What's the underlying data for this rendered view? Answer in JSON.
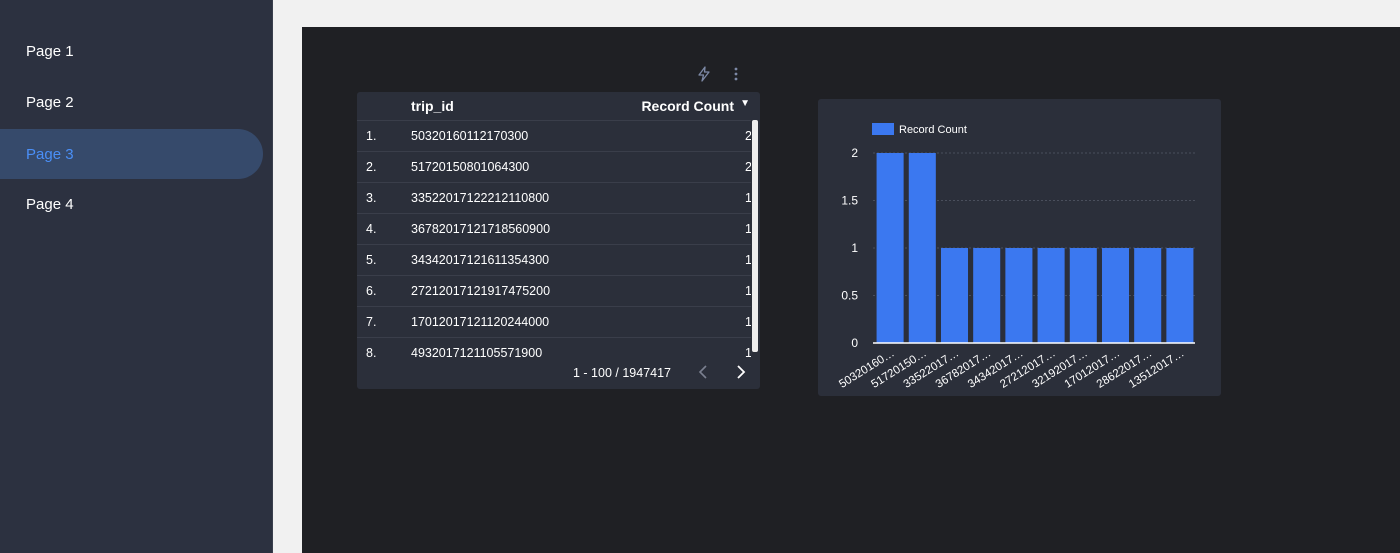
{
  "sidebar": {
    "pages": [
      {
        "label": "Page 1",
        "active": false
      },
      {
        "label": "Page 2",
        "active": false
      },
      {
        "label": "Page 3",
        "active": true
      },
      {
        "label": "Page 4",
        "active": false
      }
    ]
  },
  "toolbar": {
    "icons": [
      "lightning-icon",
      "more-vert-icon"
    ]
  },
  "table": {
    "columns": [
      "trip_id",
      "Record Count"
    ],
    "rows": [
      {
        "index": "1.",
        "trip_id": "50320160112170300",
        "count": "2"
      },
      {
        "index": "2.",
        "trip_id": "51720150801064300",
        "count": "2"
      },
      {
        "index": "3.",
        "trip_id": "33522017122212110800",
        "count": "1"
      },
      {
        "index": "4.",
        "trip_id": "36782017121718560900",
        "count": "1"
      },
      {
        "index": "5.",
        "trip_id": "34342017121611354300",
        "count": "1"
      },
      {
        "index": "6.",
        "trip_id": "27212017121917475200",
        "count": "1"
      },
      {
        "index": "7.",
        "trip_id": "17012017121120244000",
        "count": "1"
      },
      {
        "index": "8.",
        "trip_id": "4932017121105571900",
        "count": "1"
      }
    ],
    "pagination": "1 - 100 / 1947417",
    "sort_icon": "caret-down-icon"
  },
  "colors": {
    "accent": "#4a8ff7",
    "bar": "#3b78f0",
    "canvas": "#1f2024",
    "card": "#2b2f3a",
    "sidebar": "#2c3140"
  },
  "chart_data": {
    "type": "bar",
    "categories": [
      "50320160…",
      "51720150…",
      "33522017…",
      "36782017…",
      "34342017…",
      "27212017…",
      "32192017…",
      "17012017…",
      "28622017…",
      "13512017…"
    ],
    "series": [
      {
        "name": "Record Count",
        "values": [
          2,
          2,
          1,
          1,
          1,
          1,
          1,
          1,
          1,
          1
        ]
      }
    ],
    "yticks": [
      "0",
      "0.5",
      "1",
      "1.5",
      "2"
    ],
    "ylim": [
      0,
      2
    ],
    "grid": true,
    "legend": "top-left"
  }
}
